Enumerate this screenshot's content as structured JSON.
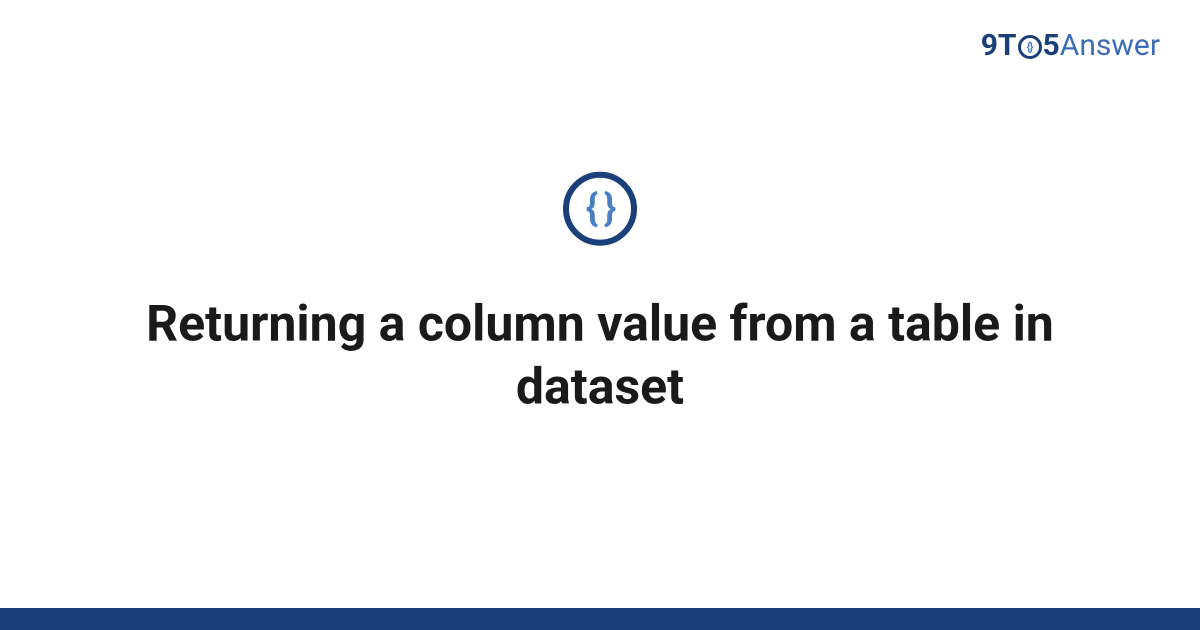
{
  "header": {
    "logo_prefix": "9T",
    "logo_number": "5",
    "logo_suffix": "Answer",
    "logo_braces": "{}"
  },
  "main": {
    "icon_braces": "{ }",
    "title": "Returning a column value from a table in dataset"
  },
  "colors": {
    "primary_dark": "#1b3f78",
    "primary_light": "#3d6db5",
    "accent": "#4a7fc5"
  }
}
